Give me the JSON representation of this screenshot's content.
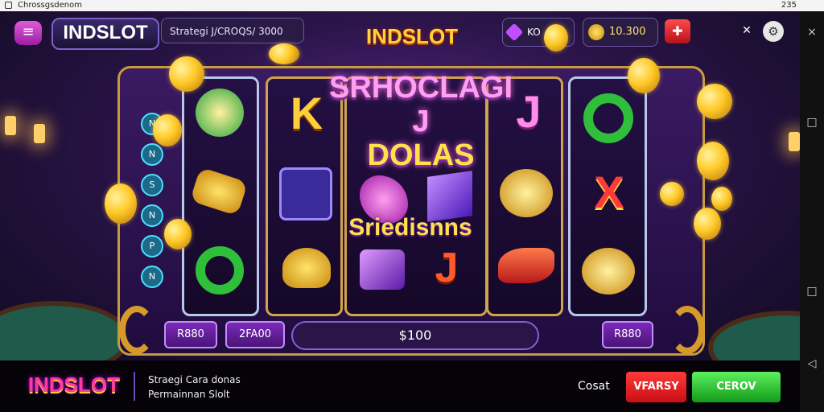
{
  "status_bar": {
    "left": "Chrossgsdenom",
    "right": "235"
  },
  "top_bar": {
    "menu_icon": "menu-icon",
    "logo": "INDSLOT",
    "strategy_text": "Strategi J/CROQS/ 3000",
    "center_logo": "INDSLOT",
    "gem_value": "KO",
    "coin_value": "10.300",
    "gift_icon": "gift-icon",
    "tool_icon": "crossed-tools-icon",
    "settings_icon": "settings-icon"
  },
  "game": {
    "headline_line1": "SRHOCLAGI J",
    "headline_line2": "DOLAS",
    "subheadline": "Sriedisnns",
    "symbols": {
      "k": "K",
      "j": "J",
      "x": "X",
      "j2": "J"
    },
    "side_icons": [
      "N",
      "N",
      "S",
      "N",
      "P",
      "N"
    ]
  },
  "controls": {
    "bet1": "R880",
    "bet2": "2FA00",
    "total": "$100",
    "bet3": "R880"
  },
  "banner": {
    "logo": "INDSLOT",
    "title": "Straegi Cara donas",
    "subtitle": "Permainnan Slolt",
    "close_label": "Cosat",
    "red_button": "VFARSY",
    "green_button": "CEROV"
  },
  "nav_bar": {
    "close": "×",
    "square": "□",
    "back": "◁"
  },
  "colors": {
    "accent_gold": "#ffd23a",
    "purple": "#5a2a8a",
    "green": "#129a1a",
    "red": "#c80f14"
  }
}
